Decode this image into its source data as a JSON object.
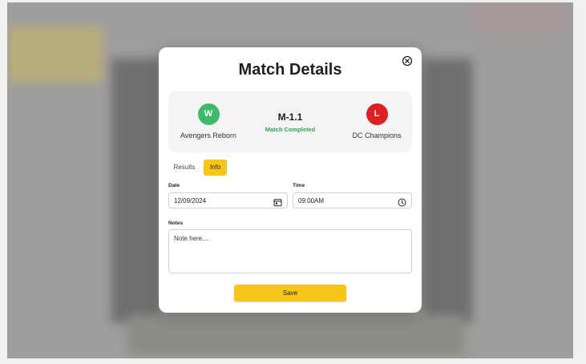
{
  "modal": {
    "title": "Match Details"
  },
  "match": {
    "home_team": {
      "name": "Avengers Reborn",
      "result": "W",
      "color": "#3dbb6b"
    },
    "away_team": {
      "name": "DC Champions",
      "result": "L",
      "color": "#e01f24"
    },
    "id": "M-1.1",
    "status": "Match Completed"
  },
  "tabs": [
    {
      "label": "Results",
      "active": false
    },
    {
      "label": "Info",
      "active": true
    }
  ],
  "form": {
    "date": {
      "label": "Date",
      "value": "12/09/2024",
      "icon": "calendar-icon"
    },
    "time": {
      "label": "Time",
      "value": "09:00AM",
      "icon": "clock-icon"
    },
    "notes": {
      "label": "Notes",
      "placeholder": "Note here...."
    }
  },
  "save_label": "Save",
  "colors": {
    "accent": "#f5c518",
    "success": "#2fa35a"
  }
}
